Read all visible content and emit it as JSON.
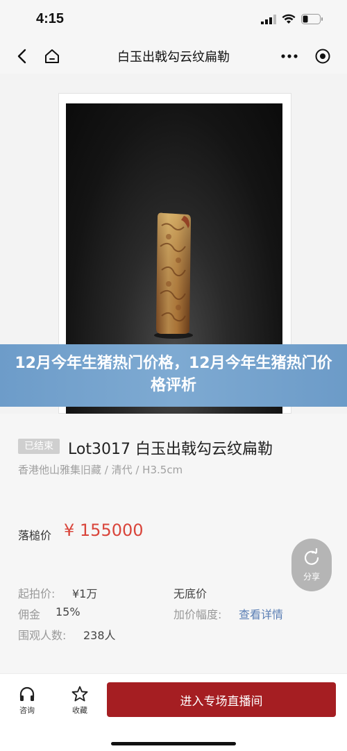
{
  "status_bar": {
    "time": "4:15"
  },
  "nav": {
    "title": "白玉出戟勾云纹扁勒"
  },
  "banner": {
    "text": "12月今年生猪热门价格，12月今年生猪热门价格评析"
  },
  "lot": {
    "status": "已结束",
    "title": "Lot3017 白玉出戟勾云纹扁勒",
    "subtitle": "香港他山雅集旧藏 / 清代 / H3.5cm",
    "hammer_label": "落槌价",
    "hammer_price": "¥ 155000"
  },
  "info": {
    "start_price_label": "起拍价:",
    "start_price_value": "¥1万",
    "reserve_value": "无底价",
    "commission_label": "佣金",
    "commission_value": "15%",
    "increment_label": "加价幅度:",
    "increment_link": "查看详情",
    "viewers_label": "围观人数:",
    "viewers_value": "238人"
  },
  "share": {
    "label": "分享"
  },
  "bottom": {
    "consult_label": "咨询",
    "favorite_label": "收藏",
    "live_button": "进入专场直播间"
  },
  "colors": {
    "accent": "#a51e22",
    "price": "#d9453b",
    "link": "#5a7eb4",
    "banner": "#7eaad2"
  }
}
